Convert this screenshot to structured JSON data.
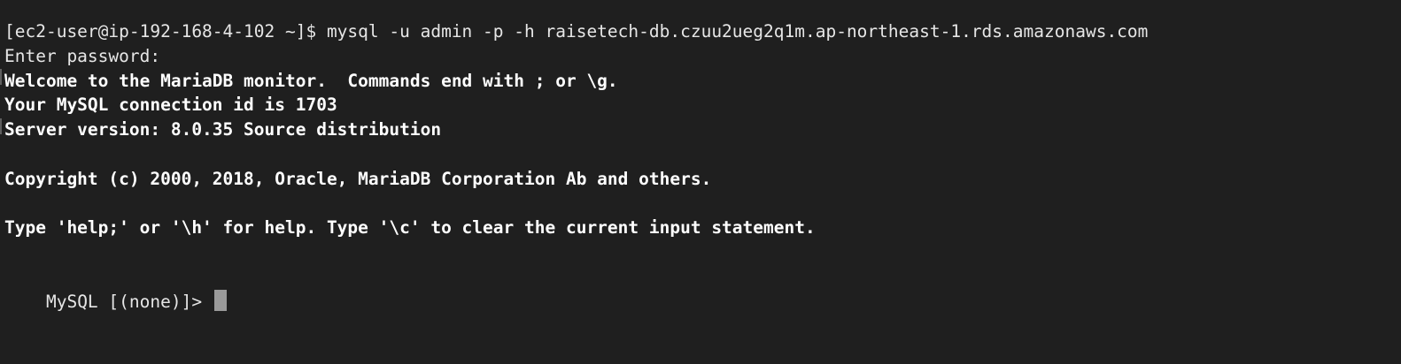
{
  "terminal": {
    "lines": [
      {
        "text": "[ec2-user@ip-192-168-4-102 ~]$ mysql -u admin -p -h raisetech-db.czuu2ueg2q1m.ap-northeast-1.rds.amazonaws.com",
        "style": "plain"
      },
      {
        "text": "Enter password:",
        "style": "plain"
      },
      {
        "text": "Welcome to the MariaDB monitor.  Commands end with ; or \\g.",
        "style": "bold"
      },
      {
        "text": "Your MySQL connection id is 1703",
        "style": "bold"
      },
      {
        "text": "Server version: 8.0.35 Source distribution",
        "style": "bold"
      },
      {
        "text": "",
        "style": "blank"
      },
      {
        "text": "Copyright (c) 2000, 2018, Oracle, MariaDB Corporation Ab and others.",
        "style": "bold"
      },
      {
        "text": "",
        "style": "blank"
      },
      {
        "text": "Type 'help;' or '\\h' for help. Type '\\c' to clear the current input statement.",
        "style": "bold"
      },
      {
        "text": "",
        "style": "blank"
      }
    ],
    "prompt": "MySQL [(none)]>",
    "colors": {
      "background": "#1f1f1f",
      "foreground": "#ffffff",
      "cursor": "#9a9a9a"
    }
  }
}
